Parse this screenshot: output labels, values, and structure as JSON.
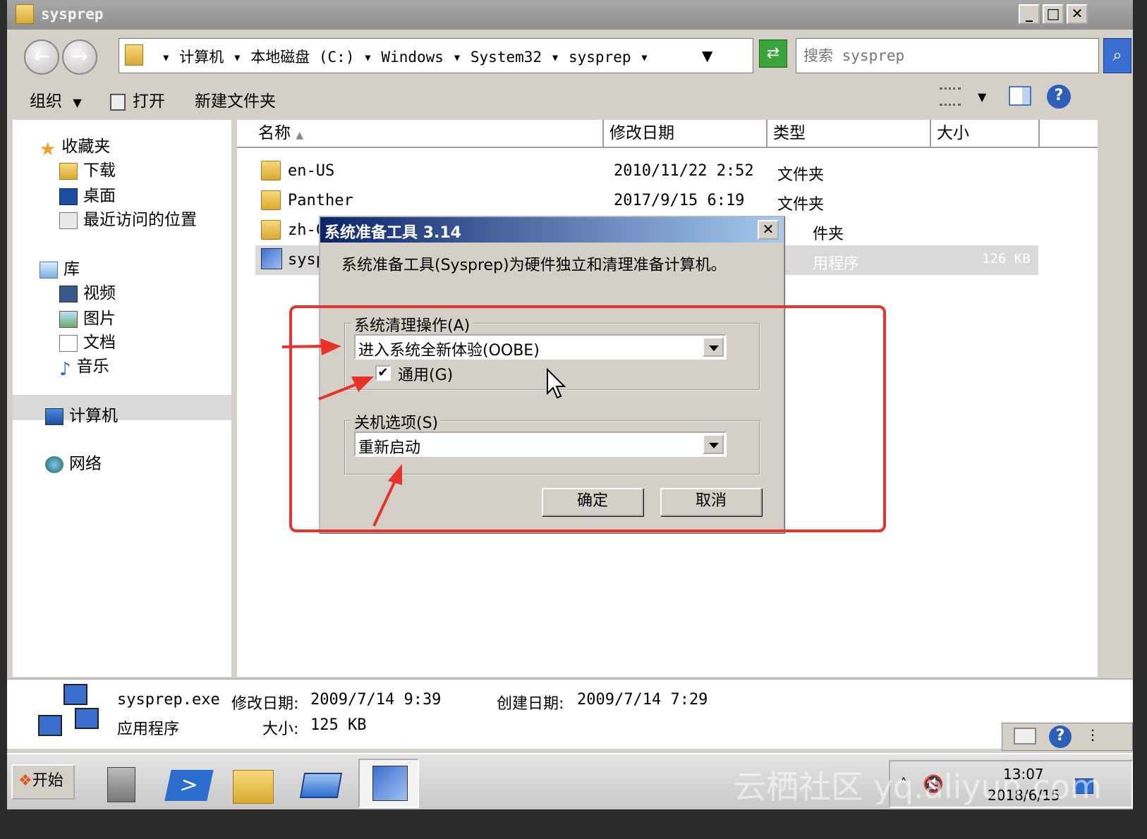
{
  "window": {
    "title": "sysprep",
    "controls": {
      "minimize": "_",
      "maximize": "□",
      "close": "✕"
    }
  },
  "address": {
    "crumbs": [
      "计算机",
      "本地磁盘 (C:)",
      "Windows",
      "System32",
      "sysprep"
    ],
    "search_placeholder": "搜索 sysprep"
  },
  "toolbar": {
    "organize": "组织",
    "open": "打开",
    "new_folder": "新建文件夹"
  },
  "nav": {
    "favorites": "收藏夹",
    "downloads": "下载",
    "desktop": "桌面",
    "recent": "最近访问的位置",
    "libraries": "库",
    "videos": "视频",
    "pictures": "图片",
    "documents": "文档",
    "music": "音乐",
    "computer": "计算机",
    "network": "网络"
  },
  "columns": {
    "name": "名称",
    "date": "修改日期",
    "type": "类型",
    "size": "大小"
  },
  "files": [
    {
      "name": "en-US",
      "date": "2010/11/22 2:52",
      "type": "文件夹",
      "size": ""
    },
    {
      "name": "Panther",
      "date": "2017/9/15 6:19",
      "type": "文件夹",
      "size": ""
    },
    {
      "name": "zh-Cl",
      "date": "",
      "type": "件夹",
      "size": ""
    },
    {
      "name": "syspı",
      "date": "",
      "type": "用程序",
      "size": "126 KB"
    }
  ],
  "details": {
    "filename": "sysprep.exe",
    "modified_label": "修改日期:",
    "modified_value": "2009/7/14 9:39",
    "created_label": "创建日期:",
    "created_value": "2009/7/14 7:29",
    "kind": "应用程序",
    "size_label": "大小:",
    "size_value": "125 KB"
  },
  "dialog": {
    "title": "系统准备工具 3.14",
    "description": "系统准备工具(Sysprep)为硬件独立和清理准备计算机。",
    "cleanup_group": "系统清理操作(A)",
    "cleanup_value": "进入系统全新体验(OOBE)",
    "generalize_label": "通用(G)",
    "generalize_checked": "✔",
    "shutdown_group": "关机选项(S)",
    "shutdown_value": "重新启动",
    "ok": "确定",
    "cancel": "取消"
  },
  "taskbar": {
    "start": "开始",
    "time": "13:07",
    "date": "2018/6/15"
  },
  "watermark": "云栖社区 yq.aliyun.com",
  "colors": {
    "annotation": "#e8332a",
    "dialog_title": "#0a246a"
  }
}
